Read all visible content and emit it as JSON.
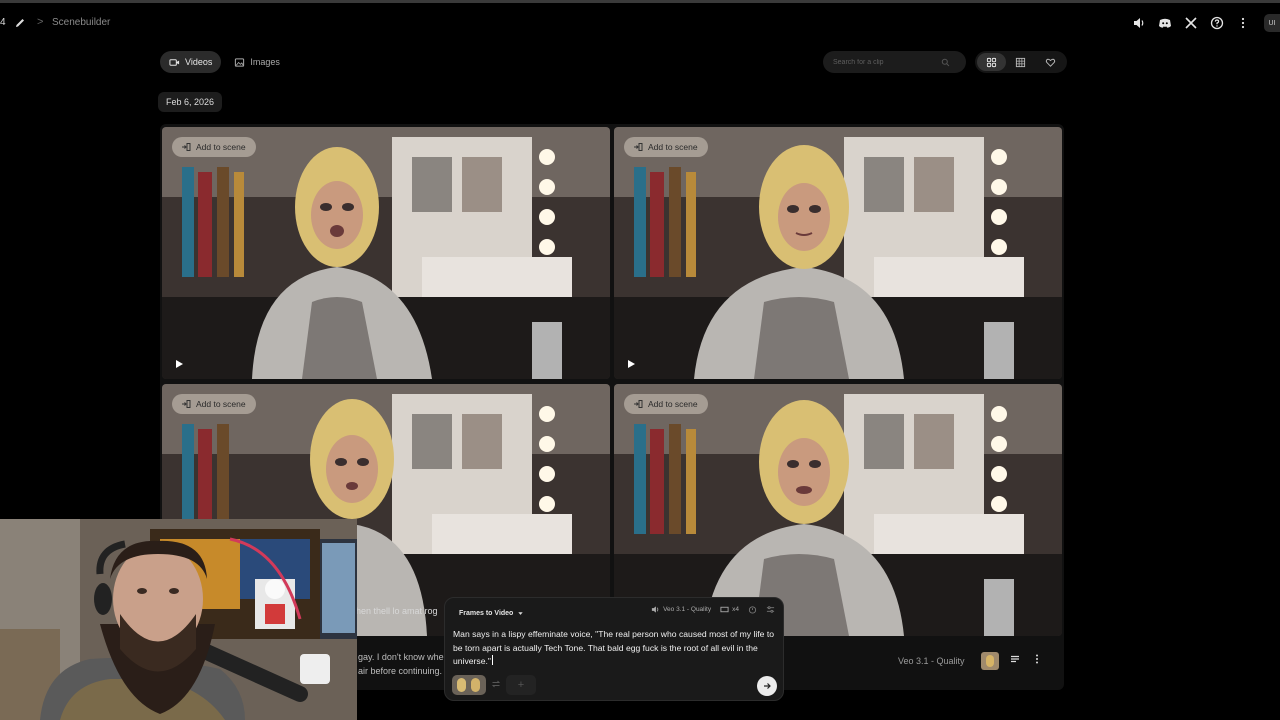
{
  "header": {
    "project_number": "4",
    "breadcrumb_separator": ">",
    "breadcrumb": "Scenebuilder",
    "user_badge": "UI"
  },
  "icons": {
    "sound": "volume-icon",
    "discord": "discord-icon",
    "x": "x-logo-icon",
    "help": "help-icon",
    "menu": "more-vertical-icon",
    "edit": "pencil-icon"
  },
  "toolbar": {
    "tabs": [
      {
        "label": "Videos",
        "active": true
      },
      {
        "label": "Images",
        "active": false
      }
    ],
    "search_placeholder": "Search for a clip"
  },
  "date_label": "Feb 6, 2026",
  "tiles": [
    {
      "add_label": "Add to scene"
    },
    {
      "add_label": "Add to scene"
    },
    {
      "add_label": "Add to scene"
    },
    {
      "add_label": "Add to scene"
    }
  ],
  "subtitles": {
    "line1": "hen thell lo amat rog",
    "line2a": "gay. I don't know whe",
    "line2b": "air before continuing."
  },
  "strip": {
    "model": "Veo 3.1 - Quality"
  },
  "prompt": {
    "mode": "Frames to Video",
    "model": "Veo 3.1 - Quality",
    "count": "x4",
    "text": "Man says in a lispy effeminate voice, \"The real person who caused most of my life to be torn apart is actually Tech Tone. That bald egg fuck is the root of all evil in the universe.\"",
    "add_frame": "+"
  },
  "colors": {
    "background": "#000000",
    "panel": "#1a1a1a",
    "accent_chip": "#2b2b2b"
  }
}
